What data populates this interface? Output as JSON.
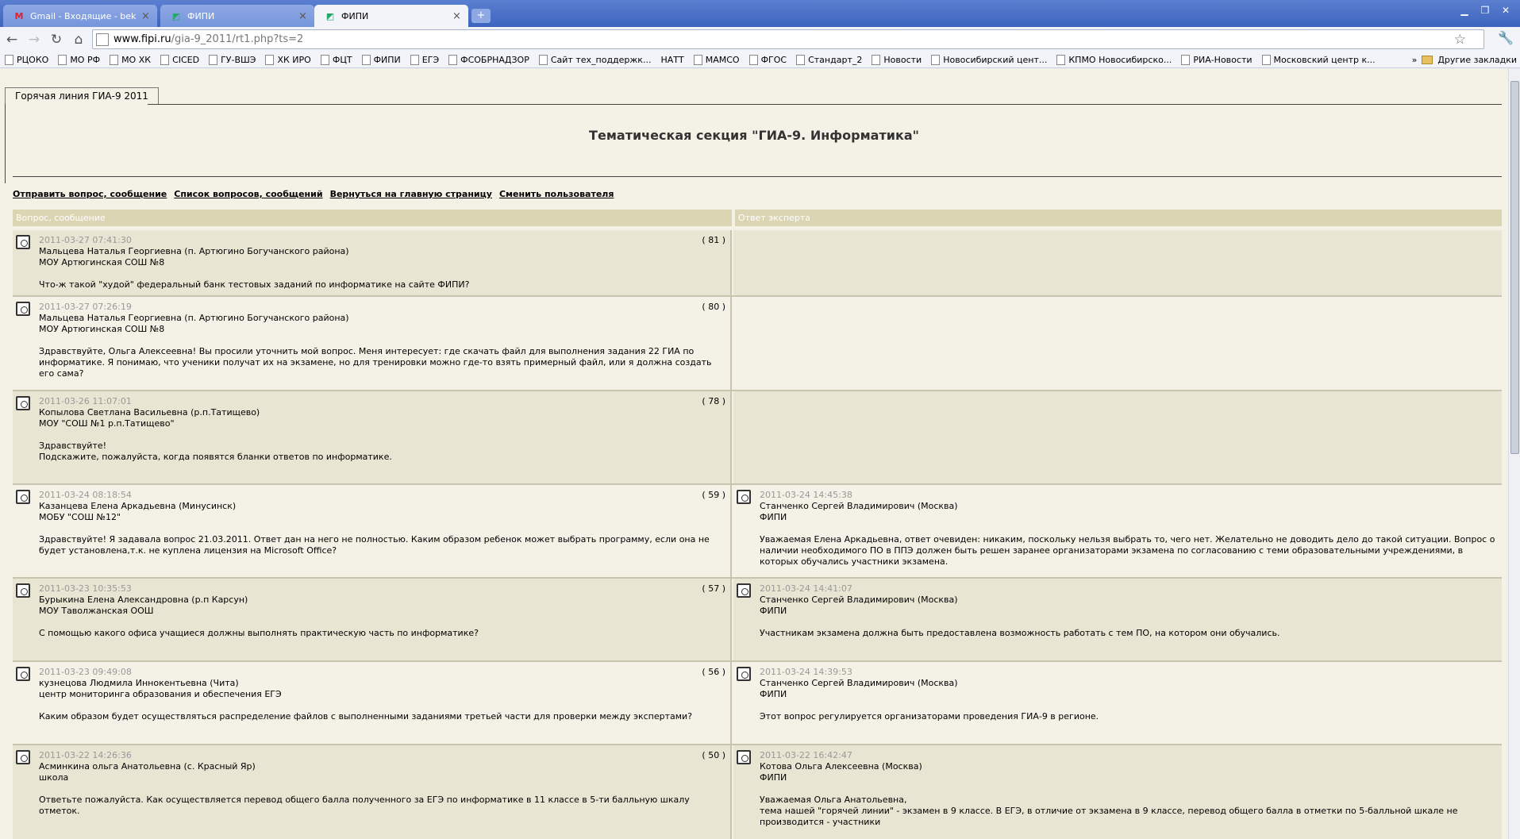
{
  "browser": {
    "tabs": [
      {
        "label": "Gmail - Входящие - beknvi...",
        "icon": "gmail-icon",
        "active": false
      },
      {
        "label": "ФИПИ",
        "icon": "fipi-icon",
        "active": false
      },
      {
        "label": "ФИПИ",
        "icon": "fipi-icon",
        "active": true
      }
    ],
    "url_domain": "www.fipi.ru",
    "url_path": "/gia-9_2011/rt1.php?ts=2",
    "bookmarks": [
      "РЦОКО",
      "МО РФ",
      "МО ХК",
      "CICED",
      "ГУ-ВШЭ",
      "ХК ИРО",
      "ФЦТ",
      "ФИПИ",
      "ЕГЭ",
      "ФСОБРНАДЗОР",
      "Сайт тех_поддержк...",
      "НАТТ",
      "МАМСО",
      "ФГОС",
      "Стандарт_2",
      "Новости",
      "Новосибирский цент...",
      "КПМО Новосибирско...",
      "РИА-Новости",
      "Московский центр к..."
    ],
    "bookmarks_more": "»",
    "other_bookmarks": "Другие закладки"
  },
  "page": {
    "tab_label": "Горячая линия ГИА-9 2011",
    "section_title": "Тематическая секция \"ГИА-9. Информатика\"",
    "links": [
      "Отправить вопрос, сообщение",
      "Список вопросов, сообщений",
      "Вернуться на главную страницу",
      "Сменить пользователя"
    ],
    "col_question": "Вопрос, сообщение",
    "col_answer": "Ответ эксперта"
  },
  "rows": [
    {
      "q": {
        "date": "2011-03-27 07:41:30",
        "num": "( 81 )",
        "author": "Мальцева Наталья Георгиевна (п. Артюгино Богучанского района)",
        "org": "МОУ Артюгинская СОШ №8",
        "text": "Что-ж такой \"худой\" федеральный банк тестовых заданий по информатике на сайте ФИПИ?"
      },
      "a": null
    },
    {
      "q": {
        "date": "2011-03-27 07:26:19",
        "num": "( 80 )",
        "author": "Мальцева Наталья Георгиевна (п. Артюгино Богучанского района)",
        "org": "МОУ Артюгинская СОШ №8",
        "text": "Здравствуйте, Ольга Алексеевна! Вы просили уточнить мой вопрос. Меня интересует: где скачать файл для выполнения задания 22 ГИА по информатике. Я понимаю, что ученики получат их на экзамене, но для тренировки можно где-то взять примерный файл, или я должна создать его сама?"
      },
      "a": null
    },
    {
      "q": {
        "date": "2011-03-26 11:07:01",
        "num": "( 78 )",
        "author": "Копылова Светлана Васильевна (р.п.Татищево)",
        "org": "МОУ \"СОШ №1 р.п.Татищево\"",
        "text": "Здравствуйте!",
        "text2": "Подскажите, пожалуйста, когда появятся бланки ответов по информатике."
      },
      "a": null
    },
    {
      "q": {
        "date": "2011-03-24 08:18:54",
        "num": "( 59 )",
        "author": "Казанцева Елена Аркадьевна (Минусинск)",
        "org": "МОБУ \"СОШ №12\"",
        "text": "Здравствуйте! Я задавала вопрос 21.03.2011. Ответ дан на него не полностью. Каким образом ребенок может выбрать программу, если она не будет установлена,т.к. не куплена лицензия на Microsoft Office?"
      },
      "a": {
        "date": "2011-03-24 14:45:38",
        "author": "Станченко Сергей Владимирович (Москва)",
        "org": "ФИПИ",
        "text": "Уважаемая Елена Аркадьевна, ответ очевиден: никаким, поскольку нельзя выбрать то, чего нет. Желательно не доводить дело до такой ситуации. Вопрос о наличии необходимого ПО в ППЭ должен быть решен заранее организаторами экзамена по согласованию с теми образовательными учреждениями, в которых обучались участники экзамена."
      }
    },
    {
      "q": {
        "date": "2011-03-23 10:35:53",
        "num": "( 57 )",
        "author": "Бурыкина Елена Александровна (р.п Карсун)",
        "org": "МОУ Таволжанская ООШ",
        "text": "С помощью какого офиса учащиеся должны выполнять практическую часть по информатике?"
      },
      "a": {
        "date": "2011-03-24 14:41:07",
        "author": "Станченко Сергей Владимирович (Москва)",
        "org": "ФИПИ",
        "text": "Участникам экзамена должна быть предоставлена возможность работать с тем ПО, на котором они обучались."
      }
    },
    {
      "q": {
        "date": "2011-03-23 09:49:08",
        "num": "( 56 )",
        "author": "кузнецова Людмила Иннокентьевна (Чита)",
        "org": "центр мониторинга образования и обеспечения ЕГЭ",
        "text": "Каким образом будет осуществляться распределение файлов с выполненными заданиями третьей части для проверки между экспертами?"
      },
      "a": {
        "date": "2011-03-24 14:39:53",
        "author": "Станченко Сергей Владимирович (Москва)",
        "org": "ФИПИ",
        "text": "Этот вопрос регулируется организаторами проведения ГИА-9 в регионе."
      }
    },
    {
      "q": {
        "date": "2011-03-22 14:26:36",
        "num": "( 50 )",
        "author": "Асминкина ольга Анатольевна (с. Красный Яр)",
        "org": "школа",
        "text": "Ответьте пожалуйста. Как осуществляется перевод общего балла полученного за ЕГЭ по информатике в 11 классе в 5-ти балльную шкалу отметок."
      },
      "a": {
        "date": "2011-03-22 16:42:47",
        "author": "Котова Ольга Алексеевна (Москва)",
        "org": "ФИПИ",
        "text": "Уважаемая Ольга Анатольевна,",
        "text2": "тема нашей \"горячей линии\" - экзамен в 9 классе. В ЕГЭ, в отличие от экзамена в 9 классе, перевод общего балла в отметки по 5-балльной шкале не производится - участники"
      }
    }
  ]
}
